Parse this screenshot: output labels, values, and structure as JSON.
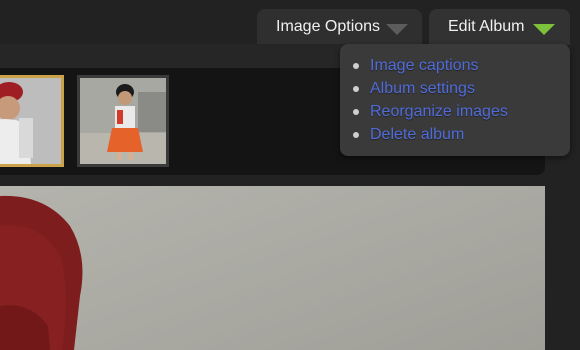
{
  "toolbar": {
    "image_options_label": "Image Options",
    "edit_album_label": "Edit Album"
  },
  "edit_album_menu": {
    "items": [
      {
        "label": "Image captions"
      },
      {
        "label": "Album settings"
      },
      {
        "label": "Reorganize images"
      },
      {
        "label": "Delete album"
      }
    ]
  },
  "thumbnails": {
    "selected_index": 0,
    "count_visible": 2
  },
  "colors": {
    "background": "#222222",
    "tab_background": "#2f2f2f",
    "menu_background": "#3a3a3a",
    "menu_link": "#4f6bd8",
    "active_caret": "#7dc23a",
    "selected_thumb_border": "#c9a24a"
  },
  "icons": {
    "image_options_caret": "chevron-down-icon",
    "edit_album_caret": "chevron-down-icon",
    "menu_bullet": "bullet-icon"
  }
}
